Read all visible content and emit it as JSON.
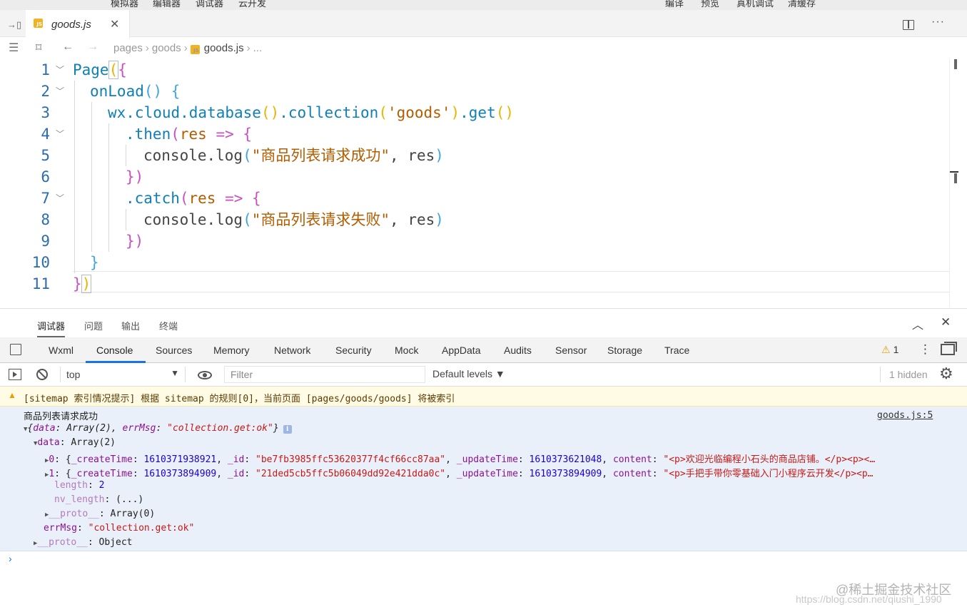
{
  "menu": [
    "模拟器",
    "编辑器",
    "调试器",
    "云开发",
    "编译",
    "预览",
    "真机调试",
    "清缓存"
  ],
  "tab": {
    "title": "goods.js",
    "badge": "JS"
  },
  "breadcrumb": {
    "parts": [
      "pages",
      "goods",
      "goods.js",
      "..."
    ]
  },
  "editor": {
    "line_numbers": [
      "1",
      "2",
      "3",
      "4",
      "5",
      "6",
      "7",
      "8",
      "9",
      "10",
      "11"
    ],
    "lines": [
      [
        "Page",
        "(",
        "{"
      ],
      [
        "onLoad",
        "()",
        " {"
      ],
      [
        "wx.cloud.database",
        "()",
        ".collection",
        "(",
        "'goods'",
        ")",
        ".get",
        "()"
      ],
      [
        ".then",
        "(",
        "res",
        " => ",
        "{"
      ],
      [
        "console.log",
        "(",
        "\"商品列表请求成功\"",
        ", ",
        "res",
        ")"
      ],
      [
        "}",
        ")"
      ],
      [
        ".catch",
        "(",
        "res",
        " => ",
        "{"
      ],
      [
        "console.log",
        "(",
        "\"商品列表请求失败\"",
        ", ",
        "res",
        ")"
      ],
      [
        "}",
        ")"
      ],
      [
        "}"
      ],
      [
        "}",
        ")"
      ]
    ]
  },
  "panel": {
    "tabs": [
      "调试器",
      "问题",
      "输出",
      "终端"
    ],
    "active": "调试器"
  },
  "devtools": {
    "tabs": [
      "Wxml",
      "Console",
      "Sources",
      "Memory",
      "Network",
      "Security",
      "Mock",
      "AppData",
      "Audits",
      "Sensor",
      "Storage",
      "Trace"
    ],
    "active": "Console",
    "warning_count": "1",
    "warning_icon": "⚠",
    "more_icon": "⋮"
  },
  "console_toolbar": {
    "context": "top",
    "filter_placeholder": "Filter",
    "levels": "Default levels ▼",
    "hidden": "1 hidden"
  },
  "console": {
    "warning": "[sitemap 索引情况提示] 根据 sitemap 的规则[0]，当前页面 [pages/goods/goods] 将被索引",
    "log_message": "商品列表请求成功",
    "log_source": "goods.js:5",
    "summary_open": "{",
    "summary_data_key": "data",
    "summary_data_val": "Array(2)",
    "summary_err_key": "errMsg",
    "summary_err_val": "\"collection.get:ok\"",
    "summary_close": "}",
    "data_key": "data",
    "data_val": "Array(2)",
    "items": [
      {
        "index": "0",
        "createTime": "1610371938921",
        "id": "\"be7fb3985ffc53620377f4cf66cc87aa\"",
        "updateTime": "1610373621048",
        "content": "\"<p>欢迎光临编程小石头的商品店铺。</p><p><…"
      },
      {
        "index": "1",
        "createTime": "1610373894909",
        "id": "\"21ded5cb5ffc5b06049dd92e421dda0c\"",
        "updateTime": "1610373894909",
        "content": "\"<p>手把手带你零基础入门小程序云开发</p><p…"
      }
    ],
    "length_key": "length",
    "length_val": "2",
    "nv_length_key": "nv_length",
    "nv_length_val": "(...)",
    "proto_key": "__proto__",
    "proto_array": "Array(0)",
    "errmsg_key": "errMsg",
    "errmsg_val": "\"collection.get:ok\"",
    "proto_object": "Object",
    "prompt": "›"
  },
  "watermark": {
    "line1": "@稀土掘金技术社区",
    "line2": "https://blog.csdn.net/qiushi_1990"
  }
}
